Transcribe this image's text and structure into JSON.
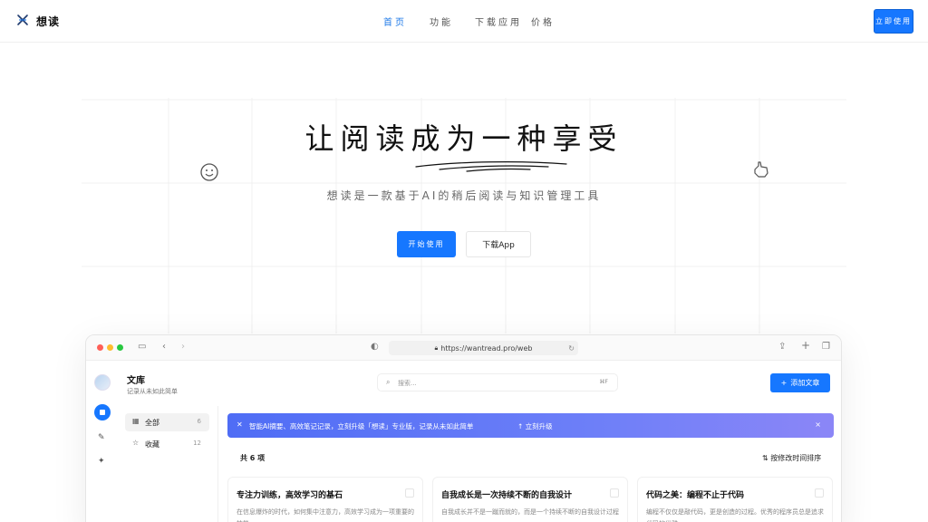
{
  "nav": {
    "brand": "想读",
    "links": [
      {
        "label": "首页",
        "active": true
      },
      {
        "label": "功能",
        "active": false
      },
      {
        "label": "下载应用",
        "active": false
      },
      {
        "label": "价格",
        "active": false
      }
    ],
    "cta": "立即使用"
  },
  "hero": {
    "title": "让阅读成为一种享受",
    "subtitle": "想读是一款基于AI的稍后阅读与知识管理工具",
    "primary_button": "开始使用",
    "secondary_button": "下载App"
  },
  "window": {
    "url": "https://wantread.pro/web",
    "library_title": "文库",
    "library_subtitle": "记录从未如此简单",
    "search_placeholder": "搜索...",
    "search_shortcut": "⌘F",
    "add_button": "添加文章",
    "sidebar": [
      {
        "icon": "calendar-icon",
        "label": "全部",
        "count": "6",
        "selected": true
      },
      {
        "icon": "star-icon",
        "label": "收藏",
        "count": "12",
        "selected": false
      }
    ],
    "banner": {
      "text": "智能AI摘要、高效笔记记录，立刻升级「想读」专业版，记录从未如此简单",
      "action": "立刻升级"
    },
    "count_label": "共 6 项",
    "sort_label": "按修改时间排序",
    "cards": [
      {
        "title": "专注力训练，高效学习的基石",
        "body": "在信息爆炸的时代，如何集中注意力，高效学习成为一项重要的技能"
      },
      {
        "title": "自我成长是一次持续不断的自我设计",
        "body": "自我成长并不是一蹴而就的，而是一个持续不断的自我设计过程"
      },
      {
        "title": "代码之美：编程不止于代码",
        "body": "编程不仅仅是敲代码，更是创造的过程。优秀的程序员总是追求代码的优雅"
      }
    ]
  },
  "colors": {
    "accent": "#1677ff",
    "banner_start": "#4f6df5",
    "banner_end": "#8b86f7"
  }
}
